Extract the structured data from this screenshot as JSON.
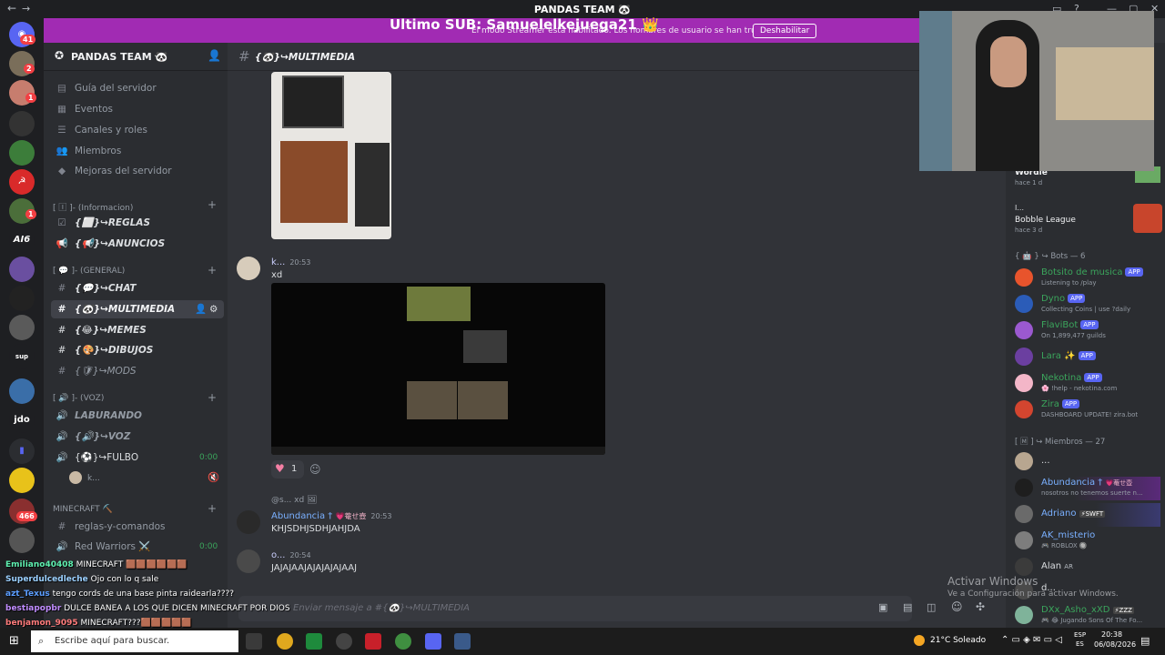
{
  "window": {
    "title": "PANDAS TEAM 🐼"
  },
  "banner": {
    "sub_text": "Ultimo SUB: Samuelelkejuega21 👑",
    "message": "El modo Streamer está habilitado. Los nombres de usuario se han truncado.",
    "disable_button": "Deshabilitar"
  },
  "rail": {
    "badges": [
      "41",
      "2",
      "1",
      "1",
      "466"
    ],
    "labels": [
      "AI6",
      "jdo",
      "sup"
    ]
  },
  "sidebar": {
    "server_name": "PANDAS TEAM 🐼",
    "top_items": [
      "Guía del servidor",
      "Eventos",
      "Canales y roles",
      "Miembros",
      "Mejoras del servidor"
    ],
    "cat1": "[ 🄸 ]- (Informacion)",
    "cat1_channels": [
      "{⬜}↪REGLAS",
      "{📢}↪ANUNCIOS"
    ],
    "cat2": "[ 💬 ]- (GENERAL)",
    "cat2_channels": [
      "{💬}↪CHAT",
      "{🐼}↪MULTIMEDIA",
      "{😂}↪MEMES",
      "{🎨}↪DIBUJOS",
      "{🛡}↪MODS"
    ],
    "cat3": "[ 🔊 ]- (VOZ)",
    "voice_channels": [
      "LABURANDO",
      "{🔊}↪VOZ",
      "{⚽}↪FULBO"
    ],
    "fulbo_time": "0:00",
    "voice_user": "k...",
    "cat4": "MINECRAFT ⛏️",
    "cat4_channels": [
      "reglas-y-comandos",
      "Red Warriors ⚔️"
    ],
    "red_time": "0:00"
  },
  "channel": {
    "name": "{🐼}↪MULTIMEDIA"
  },
  "messages": {
    "m1_author": "k...",
    "m1_time": "20:53",
    "m1_text": "xd",
    "reaction_count": "1",
    "reply_preview": "@s... xd 🖼",
    "m2_author": "Abundancia †",
    "m2_tag": "💗菴せ壺",
    "m2_time": "20:53",
    "m2_text": "KHJSDHJSDHJAHJDA",
    "m3_author": "o...",
    "m3_time": "20:54",
    "m3_text": "JAJAJAAJAJAJAJAJAAJ"
  },
  "composer": {
    "placeholder": "Enviar mensaje a #{🐼}↪MULTIMEDIA"
  },
  "members": {
    "activity1_name": "Wordle",
    "activity1_time": "hace 1 d",
    "activity2_top": "I...",
    "activity2_name": "Bobble League",
    "activity2_time": "hace 3 d",
    "bots_header": "{ 🤖 } ↪ Bots — 6",
    "bots": [
      {
        "name": "Botsito de musica",
        "status": "Listening to /play",
        "color": "#3ba55c"
      },
      {
        "name": "Dyno",
        "status": "Collecting Coins | use ?daily",
        "color": "#3ba55c"
      },
      {
        "name": "FlaviBot",
        "status": "On 1,899,477 guilds",
        "color": "#3ba55c"
      },
      {
        "name": "Lara ✨",
        "status": "",
        "color": "#3ba55c"
      },
      {
        "name": "Nekotina",
        "status": "🌸 !help - nekotina.com",
        "color": "#3ba55c"
      },
      {
        "name": "Zira",
        "status": "DASHBOARD UPDATE! zira.bot",
        "color": "#3ba55c"
      }
    ],
    "app_tag": "APP",
    "members_header": "[ 🄼 ] ↪ Miembros — 27",
    "people": [
      {
        "name": "...",
        "status": "",
        "color": "#dbdee1"
      },
      {
        "name": "Abundancia †",
        "status": "nosotros no tenemos suerte n...",
        "color": "#7ab0ff"
      },
      {
        "name": "Adriano",
        "status": "",
        "color": "#7ab0ff"
      },
      {
        "name": "AK_misterio",
        "status": "🎮 ROBLOX 🔘",
        "color": "#7ab0ff"
      },
      {
        "name": "Alan",
        "status": "",
        "color": "#dbdee1"
      },
      {
        "name": "d...",
        "status": "",
        "color": "#dbdee1"
      },
      {
        "name": "DXx_Asho_xXD",
        "status": "🎮 😂 Jugando Sons Of The Fo...",
        "color": "#3ba55c"
      }
    ],
    "abundancia_tag": "💗菴せ壺",
    "adriano_tag": "⚡SWFT",
    "alan_tag": "AR",
    "dxx_tag": "⚡ZZZ"
  },
  "stream_chat": [
    {
      "user": "Emiliano40408",
      "text": "MINECRAFT 🟫🟫🟫🟫🟫🟫",
      "color": "#5ef0b0"
    },
    {
      "user": "Superdulcedleche",
      "text": "Ojo con lo q sale",
      "color": "#9bd0ff"
    },
    {
      "user": "azt_Texus",
      "text": "tengo cords de una base pinta raidearla????",
      "color": "#5b9dff"
    },
    {
      "user": "bestiapopbr",
      "text": "DULCE BANEA A LOS QUE DICEN MINECRAFT POR DIOS",
      "color": "#c08cff"
    },
    {
      "user": "benjamon_9095",
      "text": "MINECRAFT???🟫🟫🟫🟫🟫",
      "color": "#ff7b7b"
    }
  ],
  "watermark": {
    "line1": "Activar Windows",
    "line2": "Ve a Configuración para activar Windows."
  },
  "taskbar": {
    "search_placeholder": "Escribe aquí para buscar.",
    "weather": "21°C  Soleado",
    "lang": "ESP",
    "lang2": "ES",
    "time": "20:38",
    "date": "06/08/2026"
  }
}
